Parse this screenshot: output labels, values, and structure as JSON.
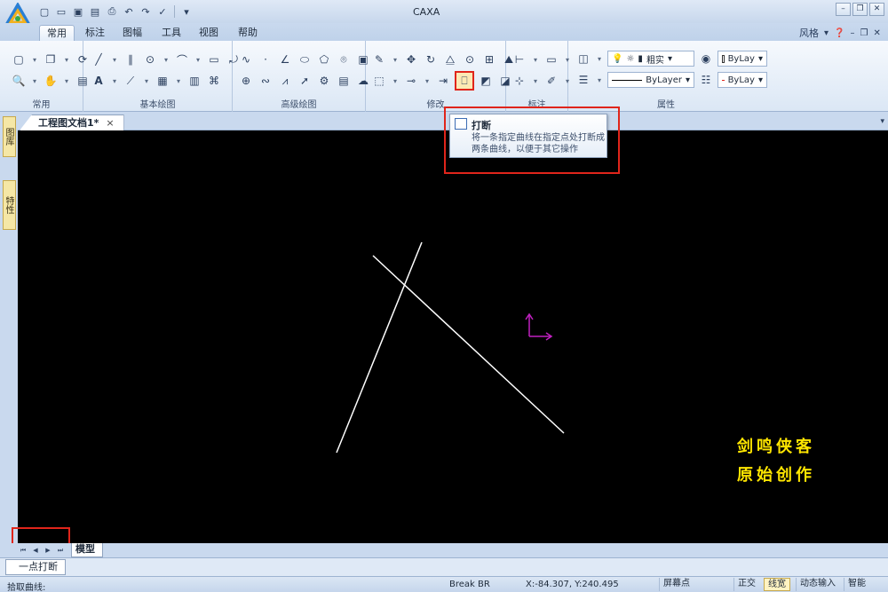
{
  "app": {
    "title": "CAXA"
  },
  "tabs": [
    "常用",
    "标注",
    "图幅",
    "工具",
    "视图",
    "帮助"
  ],
  "style_menu": {
    "label": "风格"
  },
  "ribbon": {
    "groups": [
      "常用",
      "基本绘图",
      "高级绘图",
      "修改",
      "标注",
      "属性"
    ],
    "linewidth_dropdown": "粗实",
    "layer_dropdown_1": "ByLay",
    "linetype_dropdown": "ByLayer",
    "color_dropdown": "ByLay"
  },
  "document": {
    "tab_label": "工程图文档1*",
    "close_label": "×"
  },
  "left_dock": {
    "item1": "图库",
    "item2": "特性"
  },
  "tooltip": {
    "title": "打断",
    "body": "将一条指定曲线在指定点处打断成两条曲线，以便于其它操作"
  },
  "canvas": {
    "watermark_line1": "剑鸣侠客",
    "watermark_line2": "原始创作",
    "line_color": "#ffffff",
    "ucs_color": "#c020c0"
  },
  "layout": {
    "model_tab": "模型"
  },
  "command": {
    "tab_label": "一点打断"
  },
  "status": {
    "prompt": "拾取曲线:",
    "command": "Break BR",
    "coords": "X:-84.307, Y:240.495",
    "screen_point": "屏幕点",
    "ortho": "正交",
    "linewidth": "线宽",
    "dynamic_input": "动态输入",
    "smart": "智能"
  },
  "colors": {
    "highlight_red": "#e0251b",
    "accent": "#3d6db4"
  }
}
